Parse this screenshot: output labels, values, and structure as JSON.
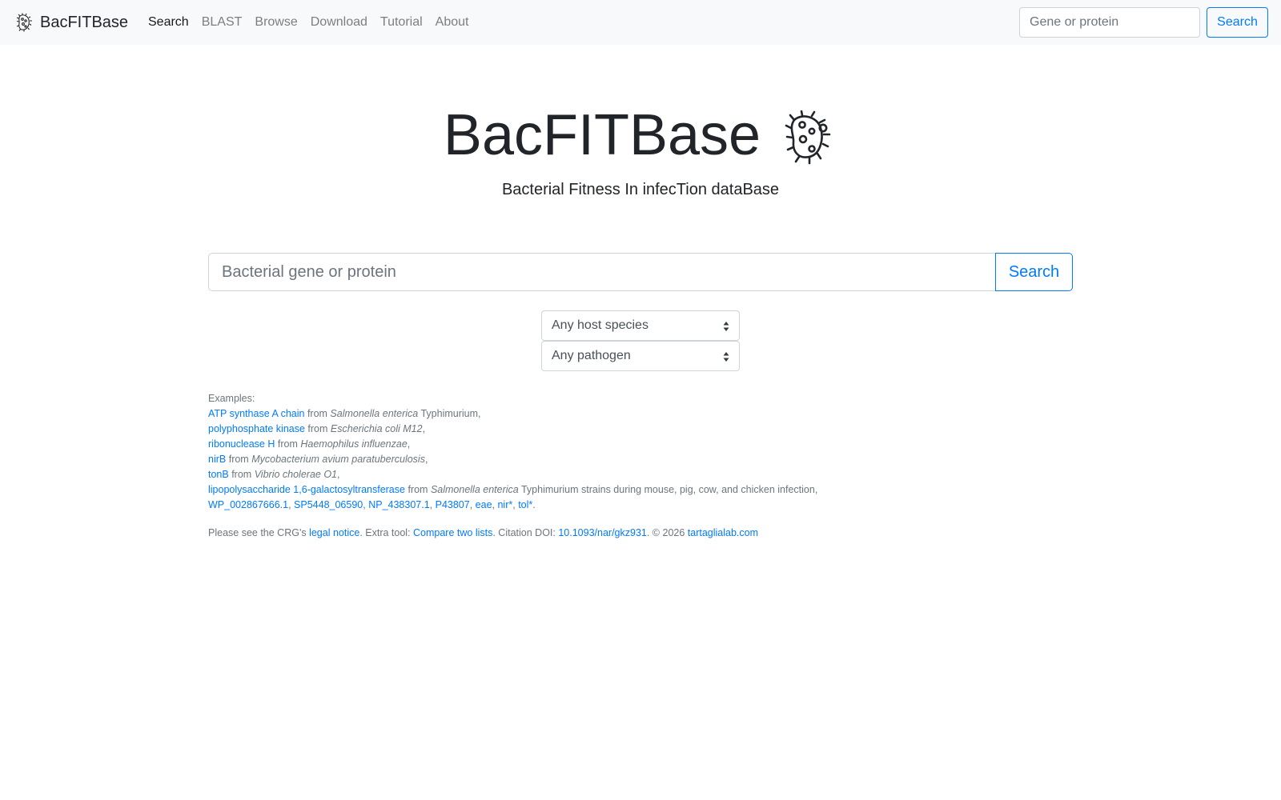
{
  "navbar": {
    "brand": "BacFITBase",
    "links": [
      "Search",
      "BLAST",
      "Browse",
      "Download",
      "Tutorial",
      "About"
    ],
    "active_link": "Search",
    "search_placeholder": "Gene or protein",
    "search_button": "Search",
    "icon": "bacteria-icon"
  },
  "hero": {
    "title": "BacFITBase",
    "subtitle": "Bacterial Fitness In infecTion dataBase",
    "icon": "bacteria-icon"
  },
  "search": {
    "placeholder": "Bacterial gene or protein",
    "button": "Search"
  },
  "filters": {
    "host": "Any host species",
    "pathogen": "Any pathogen"
  },
  "examples": {
    "label": "Examples:",
    "from": "from",
    "items": [
      {
        "gene": "ATP synthase A chain",
        "species": "Salmonella enterica",
        "suffix": " Typhimurium,"
      },
      {
        "gene": "polyphosphate kinase",
        "species": "Escherichia coli M12",
        "suffix": ","
      },
      {
        "gene": "ribonuclease H",
        "species": "Haemophilus influenzae",
        "suffix": ","
      },
      {
        "gene": "nirB",
        "species": "Mycobacterium avium paratuberculosis",
        "suffix": ","
      },
      {
        "gene": "tonB",
        "species": "Vibrio cholerae O1",
        "suffix": ","
      },
      {
        "gene": "lipopolysaccharide 1,6-galactosyltransferase",
        "species": "Salmonella enterica",
        "suffix": " Typhimurium strains during mouse, pig, cow, and chicken infection,"
      }
    ],
    "ids": [
      "WP_002867666.1",
      "SP5448_06590",
      "NP_438307.1",
      "P43807",
      "eae",
      "nir*",
      "tol*"
    ]
  },
  "footer": {
    "text1": "Please see the CRG's ",
    "legal_link": "legal notice",
    "text2": ". Extra tool: ",
    "compare_link": "Compare two lists",
    "text3": ". Citation DOI: ",
    "doi_link": "10.1093/nar/gkz931",
    "text4": ". © 2026 ",
    "lab_link": "tartaglialab.com"
  },
  "colors": {
    "link": "#007bff",
    "muted": "#6c757d",
    "navbar_bg": "#f8f9fa"
  }
}
